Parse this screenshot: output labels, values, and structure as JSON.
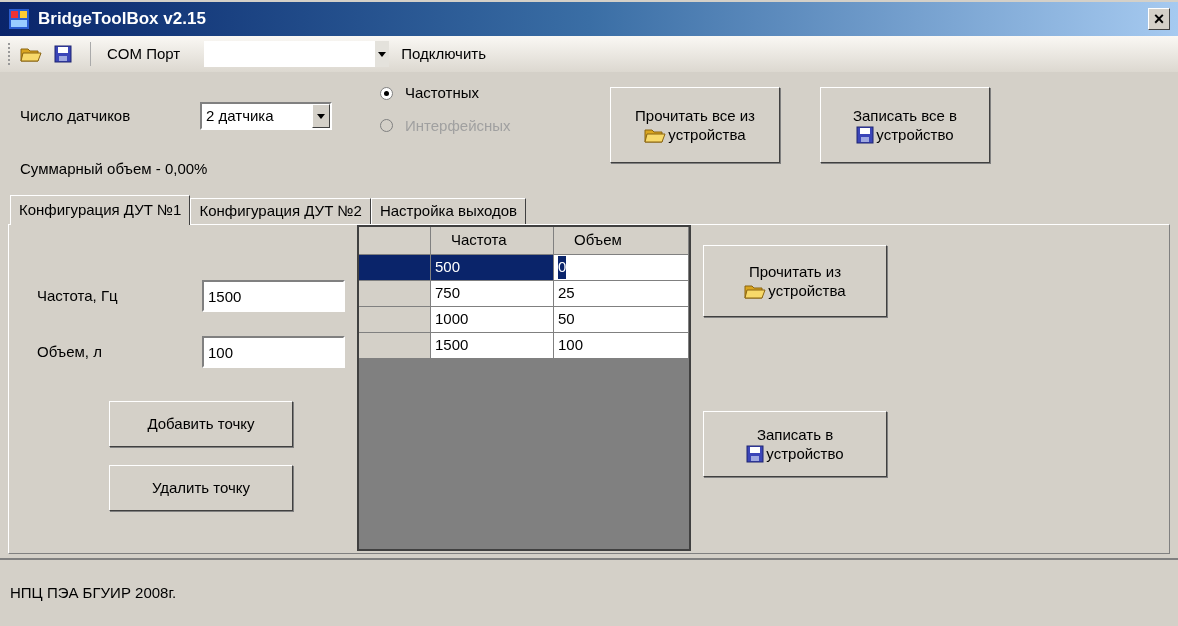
{
  "window": {
    "title": "BridgeToolBox v2.15",
    "close": "×"
  },
  "toolbar": {
    "port_label": "COM Порт",
    "connect": "Подключить"
  },
  "sensors": {
    "label": "Число датчиков",
    "value": "2 датчика"
  },
  "sensor_types": [
    {
      "label": "Частотных",
      "checked": true,
      "disabled": false
    },
    {
      "label": "Интерфейсных",
      "checked": false,
      "disabled": true
    }
  ],
  "top_buttons": [
    {
      "lines": [
        "Прочитать все из",
        "устройства"
      ],
      "kind": "read"
    },
    {
      "lines": [
        "Записать все в",
        "устройство"
      ],
      "kind": "write"
    }
  ],
  "total": "Суммарный объем - 0,00%",
  "tabs": [
    {
      "label": "Конфигурация ДУТ №1",
      "selected": true
    },
    {
      "label": "Конфигурация ДУТ №2",
      "selected": false
    },
    {
      "label": "Настройка выходов",
      "selected": false
    }
  ],
  "fields": [
    {
      "label": "Частота, Гц",
      "value": "1500"
    },
    {
      "label": "Объем, л",
      "value": "100"
    }
  ],
  "point_buttons": [
    "Добавить точку",
    "Удалить точку"
  ],
  "table": {
    "columns": [
      "Частота",
      "Объем"
    ],
    "rows": [
      {
        "cells": [
          "500",
          "0"
        ],
        "selected": true
      },
      {
        "cells": [
          "750",
          "25"
        ],
        "selected": false
      },
      {
        "cells": [
          "1000",
          "50"
        ],
        "selected": false
      },
      {
        "cells": [
          "1500",
          "100"
        ],
        "selected": false
      }
    ]
  },
  "side_buttons": [
    {
      "lines": [
        "Прочитать из",
        "устройства"
      ],
      "kind": "read"
    },
    {
      "lines": [
        "Записать в",
        "устройство"
      ],
      "kind": "write"
    }
  ],
  "status_bar": "НПЦ ПЭА БГУИР 2008г."
}
